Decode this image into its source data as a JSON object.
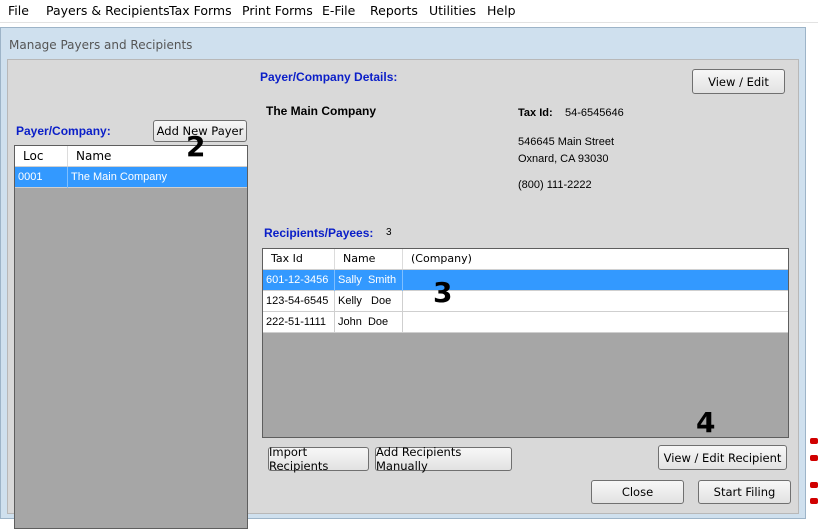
{
  "menu": [
    "File",
    "Payers & Recipients",
    "Tax Forms",
    "Print Forms",
    "E-File",
    "Reports",
    "Utilities",
    "Help"
  ],
  "window_title": "Manage Payers and Recipients",
  "payer_panel": {
    "label": "Payer/Company:",
    "add_button": "Add New Payer",
    "columns": [
      "Loc",
      "Name"
    ],
    "rows": [
      {
        "loc": "0001",
        "name": "The Main Company"
      }
    ]
  },
  "details": {
    "label": "Payer/Company Details:",
    "view_edit_button": "View / Edit",
    "company_name": "The Main Company",
    "tax_id_label": "Tax Id:",
    "tax_id_value": "54-6545646",
    "address_line1": "546645 Main Street",
    "address_line2": "Oxnard, CA  93030",
    "phone": "(800) 111-2222"
  },
  "recipients": {
    "label": "Recipients/Payees:",
    "count": "3",
    "columns": [
      "Tax Id",
      "Name",
      "(Company)"
    ],
    "rows": [
      {
        "tax_id": "601-12-3456",
        "name": "Sally  Smith",
        "company": ""
      },
      {
        "tax_id": "123-54-6545",
        "name": "Kelly   Doe",
        "company": ""
      },
      {
        "tax_id": "222-51-1111",
        "name": "John  Doe",
        "company": ""
      }
    ],
    "import_button": "Import Recipients",
    "add_manual_button": "Add Recipients Manually",
    "view_edit_button": "View / Edit Recipient"
  },
  "footer": {
    "close_button": "Close",
    "start_button": "Start Filing"
  },
  "annotations": {
    "n2": "2",
    "n3": "3",
    "n4": "4"
  },
  "colors": {
    "label_blue": "#0a1ec8",
    "selection": "#3399ff",
    "window_border": "#cfe0ee"
  }
}
